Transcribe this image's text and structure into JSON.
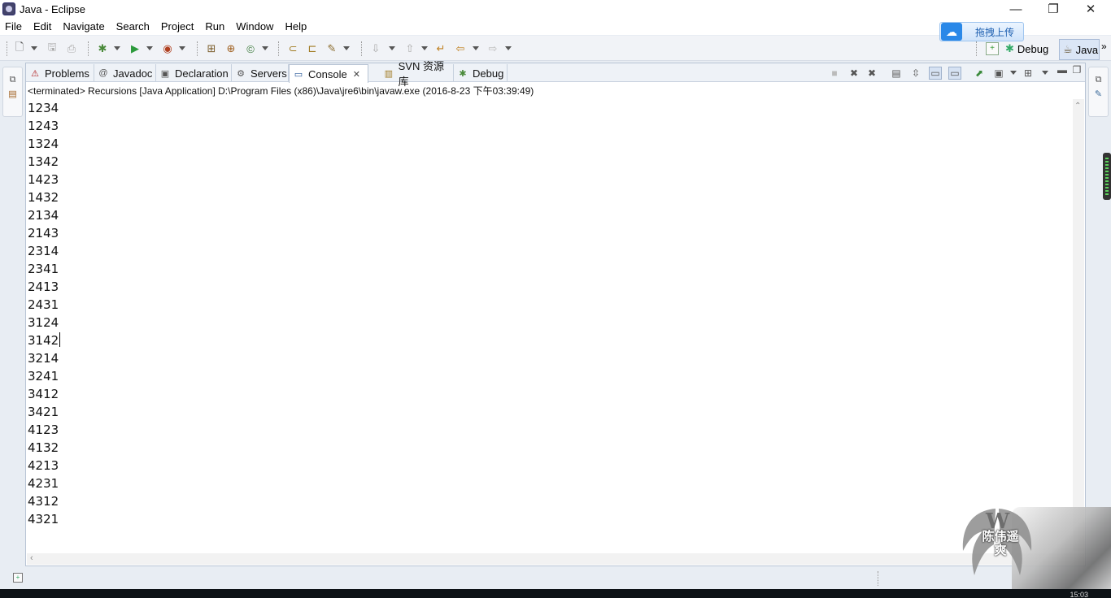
{
  "window": {
    "title": "Java - Eclipse"
  },
  "menu": [
    "File",
    "Edit",
    "Navigate",
    "Search",
    "Project",
    "Run",
    "Window",
    "Help"
  ],
  "upload_widget": {
    "label": "拖拽上传",
    "icon": "cloud-icon"
  },
  "perspectives": {
    "debug": "Debug",
    "java": "Java",
    "more": "»"
  },
  "tabs": [
    {
      "label": "Problems",
      "icon": "problems-icon"
    },
    {
      "label": "Javadoc",
      "icon": "javadoc-icon"
    },
    {
      "label": "Declaration",
      "icon": "declaration-icon"
    },
    {
      "label": "Servers",
      "icon": "servers-icon"
    },
    {
      "label": "Console",
      "icon": "console-icon",
      "active": true
    },
    {
      "label": "SVN 资源库",
      "icon": "svn-icon"
    },
    {
      "label": "Debug",
      "icon": "debug-icon"
    }
  ],
  "console": {
    "header": "<terminated> Recursions [Java Application] D:\\Program Files (x86)\\Java\\jre6\\bin\\javaw.exe (2016-8-23 下午03:39:49)",
    "lines": [
      "1234",
      "1243",
      "1324",
      "1342",
      "1423",
      "1432",
      "2134",
      "2143",
      "2314",
      "2341",
      "2413",
      "2431",
      "3124",
      "3142",
      "3214",
      "3241",
      "3412",
      "3421",
      "4123",
      "4132",
      "4213",
      "4231",
      "4312",
      "4321"
    ],
    "caret_line": 13
  },
  "watermark": {
    "text_line1": "陈伟遥",
    "text_line2": "爽"
  },
  "taskbar": {
    "clock": "15:03"
  },
  "colors": {
    "accent": "#2a88e8",
    "selection": "#d6e2f3",
    "view_border": "#b8c4d4"
  }
}
